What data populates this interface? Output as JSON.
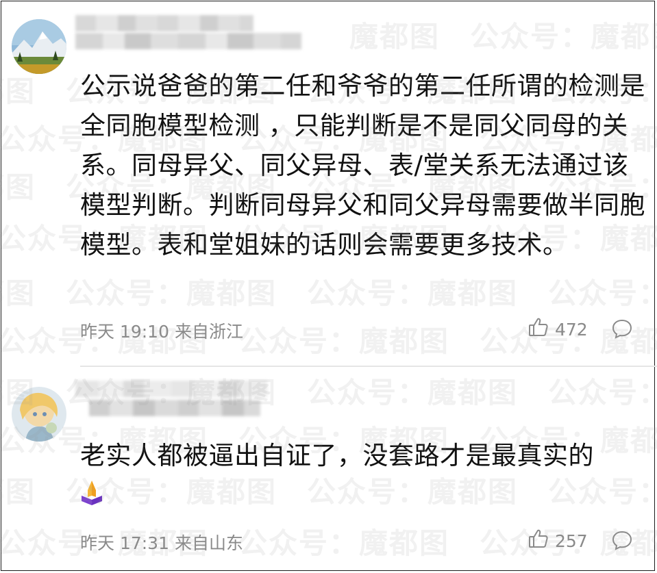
{
  "watermark": {
    "text": "魔都图　公众号：魔都图　公众号：魔都图　公众号：魔都图　公众号："
  },
  "comments": [
    {
      "text": "公示说爸爸的第二任和爷爷的第二任所谓的检测是 全同胞模型检测 ，只能判断是不是同父同母的关系。同母异父、同父异母、表/堂关系无法通过该模型判断。判断同母异父和同父异母需要做半同胞模型。表和堂姐妹的话则会需要更多技术。",
      "time": "昨天 19:10",
      "location": "来自浙江",
      "likes": "472"
    },
    {
      "text": "老实人都被逼出自证了，没套路才是最真实的",
      "time": "昨天 17:31",
      "location": "来自山东",
      "likes": "257"
    }
  ],
  "icons": {
    "like": "thumbs-up-icon",
    "reply": "speech-bubble-icon",
    "emoji": "praying-hands-emoji"
  },
  "colors": {
    "text": "#111111",
    "meta": "#8a8a8a",
    "divider": "#e5e5e5"
  }
}
